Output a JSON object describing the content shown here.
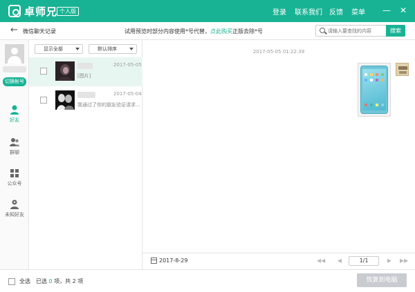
{
  "app": {
    "title": "卓师兄",
    "edition": "个人版",
    "nav": [
      "登录",
      "联系我们",
      "反馈",
      "菜单"
    ],
    "window_controls": {
      "minimize": "—",
      "close": "✕"
    }
  },
  "toolbar": {
    "page_title": "微信聊天记录",
    "notice_prefix": "试用预览时部分内容使用*号代替，",
    "notice_link": "点此购买",
    "notice_suffix": "正版去除*号",
    "search_placeholder": "请输入要查找的内容",
    "search_button": "搜索"
  },
  "sidebar": {
    "switch_account": "切换帐号",
    "items": [
      {
        "label": "好友",
        "icon": "person-icon",
        "active": true
      },
      {
        "label": "群聊",
        "icon": "group-icon",
        "active": false
      },
      {
        "label": "公众号",
        "icon": "grid-icon",
        "active": false
      },
      {
        "label": "未知好友",
        "icon": "unknown-person-icon",
        "active": false
      }
    ]
  },
  "list": {
    "filter_dropdown": "显示全部",
    "sort_dropdown": "默认排序",
    "contacts": [
      {
        "date": "2017-05-05",
        "preview": "[图片]",
        "selected": true
      },
      {
        "date": "2017-05-04",
        "preview": "我通过了你的朋友验证请求...",
        "selected": false
      }
    ]
  },
  "chat": {
    "timestamp": "2017-05-05 01:22:39",
    "message_type": "image"
  },
  "footer": {
    "date": "2017-8-29",
    "page": "1/1"
  },
  "bottom": {
    "select_all": "全选",
    "selected_prefix": "已选",
    "selected_count": "0",
    "selected_mid": "项，共",
    "total_count": "2",
    "selected_suffix": "项",
    "restore_button": "恢复到电脑"
  },
  "colors": {
    "accent": "#18b394",
    "disabled_button": "#c8ccd0"
  }
}
